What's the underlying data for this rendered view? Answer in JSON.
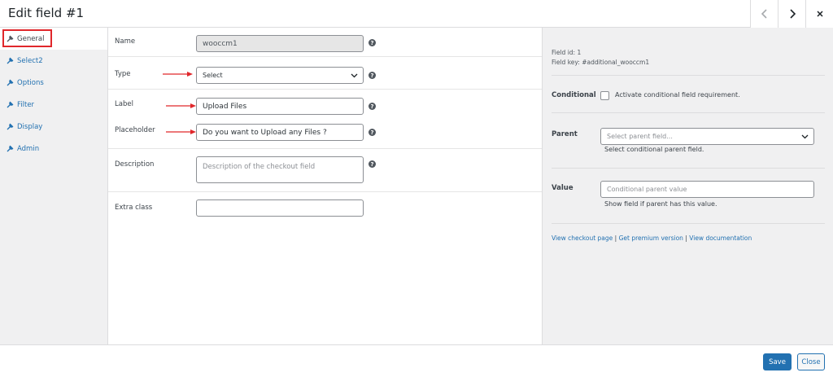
{
  "header": {
    "title": "Edit field #1"
  },
  "sidebar": {
    "items": [
      {
        "label": "General"
      },
      {
        "label": "Select2"
      },
      {
        "label": "Options"
      },
      {
        "label": "Filter"
      },
      {
        "label": "Display"
      },
      {
        "label": "Admin"
      }
    ]
  },
  "form": {
    "name": {
      "label": "Name",
      "value": "wooccm1"
    },
    "type": {
      "label": "Type",
      "value": "Select"
    },
    "field_label": {
      "label": "Label",
      "value": "Upload Files"
    },
    "placeholder": {
      "label": "Placeholder",
      "value": "Do you want to Upload any Files ?"
    },
    "description": {
      "label": "Description",
      "placeholder": "Description of the checkout field"
    },
    "extra_class": {
      "label": "Extra class",
      "value": ""
    },
    "help_glyph": "?"
  },
  "right_panel": {
    "field_id": "Field id: 1",
    "field_key": "Field key: #additional_wooccm1",
    "conditional": {
      "label": "Conditional",
      "checkbox_text": "Activate conditional field requirement."
    },
    "parent": {
      "label": "Parent",
      "placeholder": "Select parent field...",
      "hint": "Select conditional parent field."
    },
    "value": {
      "label": "Value",
      "placeholder": "Conditional parent value",
      "hint": "Show field if parent has this value."
    },
    "links": {
      "checkout": "View checkout page",
      "premium": "Get premium version",
      "docs": "View documentation",
      "separator": "|"
    }
  },
  "footer": {
    "save_label": "Save",
    "close_label": "Close"
  },
  "colors": {
    "accent": "#2271b1",
    "highlight": "#e0272b"
  }
}
